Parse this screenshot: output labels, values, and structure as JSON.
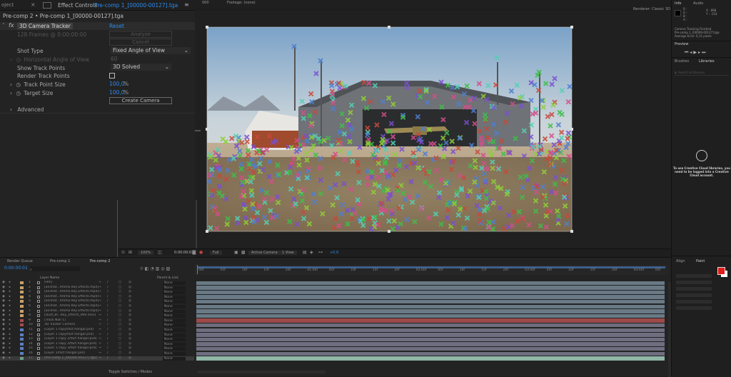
{
  "window": {
    "left_tab_partial": "oject",
    "ec_tab": "Effect Controls",
    "ec_comp": "Pre-comp 1_[00000-00127].tga",
    "ec_menu": "≡",
    "viewer_tab_a": "000",
    "viewer_tab_b": "Footage: (none)",
    "render_label": "Renderer:",
    "render_value": "Classic 3D"
  },
  "effect_controls": {
    "breadcrumb": "Pre-comp 2 • Pre-comp 1_[00000-00127].tga",
    "effect_name": "3D Camera Tracker",
    "reset": "Reset",
    "frames_info": "128 Frames @ 0:00:00:00",
    "analyze": "Analyze",
    "cancel": "Cancel",
    "shot_type_label": "Shot Type",
    "shot_type_value": "Fixed Angle of View",
    "hfov_label": "Horizontal Angle of View",
    "hfov_value": "60",
    "show_points_label": "Show Track Points",
    "show_points_value": "3D Solved",
    "render_points_label": "Render Track Points",
    "point_size_label": "Track Point Size",
    "point_size_value": "100,0",
    "target_size_label": "Target Size",
    "target_size_value": "100,0",
    "percent": "%",
    "create_camera": "Create Camera",
    "advanced": "Advanced"
  },
  "viewer_toolbar": {
    "zoom": "100%",
    "timecode": "0:00:00:01",
    "resolution": "Full",
    "camera": "Active Camera",
    "views": "1 View",
    "plus": "+0,0"
  },
  "right_panel": {
    "info_tab": "Info",
    "audio_tab": "Audio",
    "r": "R :",
    "g": "G :",
    "b": "B :",
    "a": "A :",
    "x": "X : 898",
    "y": "Y : -154",
    "msg1": "Camera Tracking Finished",
    "msg2": "Pre-comp 1_[00000-00127].tga",
    "msg3": "Average Error: 0,11 pixels",
    "preview_tab": "Preview",
    "brushes_tab": "Brushes",
    "libraries_tab": "Libraries",
    "search": "Search all libraries",
    "cc_message": "To use Creative Cloud libraries, you need to be logged into a Creative Cloud account.",
    "align_tab": "Align",
    "paint_tab": "Paint",
    "accent": "#e21b1b"
  },
  "timeline": {
    "tab_render": "Render Queue",
    "tab_pc1": "Pre-comp 1",
    "tab_pc2": "Pre-comp 2",
    "time": "0:00:00:01",
    "col_layer_name": "Layer Name",
    "col_parent": "Parent & Link",
    "footer": "Toggle Switches / Modes",
    "ticks": [
      "00f",
      "05f",
      "10f",
      "15f",
      "20f",
      "01:00f",
      "05f",
      "10f",
      "15f",
      "20f",
      "02:00f",
      "05f",
      "10f",
      "15f",
      "20f",
      "03:00f",
      "05f",
      "10f",
      "15f",
      "20f",
      "04:00f",
      "05f"
    ],
    "layers": [
      {
        "num": "1",
        "name": "[Hm]",
        "parent": "None"
      },
      {
        "num": "2",
        "name": "[animat...Ammo Key Effects.mp4]",
        "parent": "None"
      },
      {
        "num": "3",
        "name": "[animat...Ammo Key Effects.mp4]",
        "parent": "None"
      },
      {
        "num": "4",
        "name": "[animat...Ammo Key Effects.mp4]",
        "parent": "None"
      },
      {
        "num": "5",
        "name": "[animat...Ammo Key Effects.mp4]",
        "parent": "None"
      },
      {
        "num": "6",
        "name": "[animat...Ammo Key Effects.mp4]",
        "parent": "None"
      },
      {
        "num": "7",
        "name": "[animat...Ammo Key Effects.mp4]",
        "parent": "None"
      },
      {
        "num": "8",
        "name": "[Dust_Bl...Key_Effects_MAI.mov]",
        "parent": "None"
      },
      {
        "num": "9",
        "name": "[Track Null 1]",
        "parent": "None"
      },
      {
        "num": "10",
        "name": "3D Tracker Camera",
        "parent": "None"
      },
      {
        "num": "11",
        "name": "[Layer 1 copy/fact hangar.psd]",
        "parent": "None"
      },
      {
        "num": "12",
        "name": "[Layer 1 copy/fact hangar.psd]",
        "parent": "None"
      },
      {
        "num": "13",
        "name": "[Layer 1 copy 2/fact hangar.psd]",
        "parent": "None"
      },
      {
        "num": "14",
        "name": "[Layer 1 copy 3/fact hangar.psd]",
        "parent": "None"
      },
      {
        "num": "15",
        "name": "[Layer 1 copy 3/fact hangar.psd]",
        "parent": "None"
      },
      {
        "num": "16",
        "name": "[Layer 1/fact hangar.psd]",
        "parent": "None"
      },
      {
        "num": "17",
        "name": "[Pre-comp 1_[00000-00127].tga]",
        "parent": "None"
      }
    ]
  }
}
